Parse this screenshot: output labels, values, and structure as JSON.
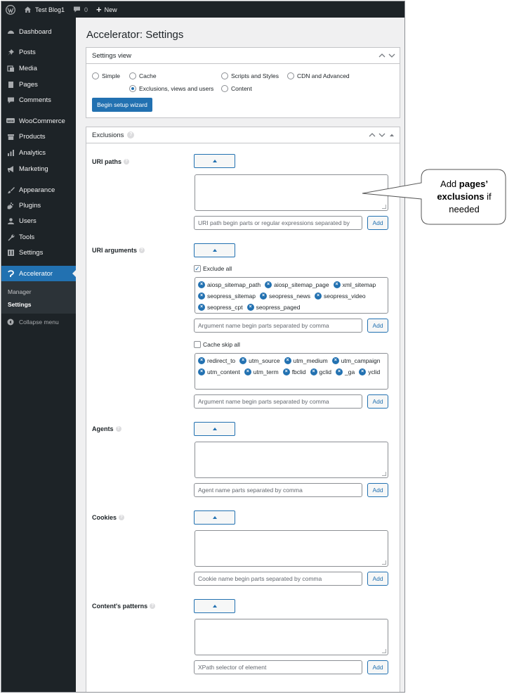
{
  "adminbar": {
    "site_name": "Test Blog1",
    "comments_count": "0",
    "new_label": "New"
  },
  "sidebar": {
    "items": [
      {
        "label": "Dashboard",
        "icon": "dashboard-icon"
      },
      {
        "label": "Posts",
        "icon": "pin-icon"
      },
      {
        "label": "Media",
        "icon": "media-icon"
      },
      {
        "label": "Pages",
        "icon": "pages-icon"
      },
      {
        "label": "Comments",
        "icon": "comment-icon"
      },
      {
        "label": "WooCommerce",
        "icon": "woo-icon"
      },
      {
        "label": "Products",
        "icon": "archive-icon"
      },
      {
        "label": "Analytics",
        "icon": "bar-chart-icon"
      },
      {
        "label": "Marketing",
        "icon": "megaphone-icon"
      },
      {
        "label": "Appearance",
        "icon": "brush-icon"
      },
      {
        "label": "Plugins",
        "icon": "plug-icon"
      },
      {
        "label": "Users",
        "icon": "user-icon"
      },
      {
        "label": "Tools",
        "icon": "wrench-icon"
      },
      {
        "label": "Settings",
        "icon": "settings-icon"
      },
      {
        "label": "Accelerator",
        "icon": "accelerator-icon"
      }
    ],
    "submenu": [
      "Manager",
      "Settings"
    ],
    "collapse_label": "Collapse menu"
  },
  "page_title": "Accelerator: Settings",
  "settings_view": {
    "title": "Settings view",
    "options": [
      "Simple",
      "Cache",
      "Scripts and Styles",
      "CDN and Advanced",
      "Exclusions, views and users",
      "Content"
    ],
    "selected": "Exclusions, views and users",
    "wizard_button": "Begin setup wizard"
  },
  "exclusions": {
    "title": "Exclusions",
    "uri_paths": {
      "label": "URI paths",
      "placeholder": "URI path begin parts or regular expressions separated by",
      "add": "Add"
    },
    "uri_arguments": {
      "label": "URI arguments",
      "exclude_all_label": "Exclude all",
      "exclude_all_checked": true,
      "exclude_tags": [
        "aiosp_sitemap_path",
        "aiosp_sitemap_page",
        "xml_sitemap",
        "seopress_sitemap",
        "seopress_news",
        "seopress_video",
        "seopress_cpt",
        "seopress_paged"
      ],
      "exclude_placeholder": "Argument name begin parts separated by comma",
      "cache_skip_label": "Cache skip all",
      "cache_skip_checked": false,
      "skip_tags": [
        "redirect_to",
        "utm_source",
        "utm_medium",
        "utm_campaign",
        "utm_content",
        "utm_term",
        "fbclid",
        "gclid",
        "_ga",
        "yclid"
      ],
      "skip_placeholder": "Argument name begin parts separated by comma",
      "add": "Add"
    },
    "agents": {
      "label": "Agents",
      "placeholder": "Agent name parts separated by comma",
      "add": "Add"
    },
    "cookies": {
      "label": "Cookies",
      "placeholder": "Cookie name begin parts separated by comma",
      "add": "Add"
    },
    "contents_patterns": {
      "label": "Content's patterns",
      "placeholder": "XPath selector of element",
      "add": "Add"
    }
  },
  "callout": {
    "prefix": "Add ",
    "bold": "pages’ exclusions",
    "suffix": " if needed"
  }
}
